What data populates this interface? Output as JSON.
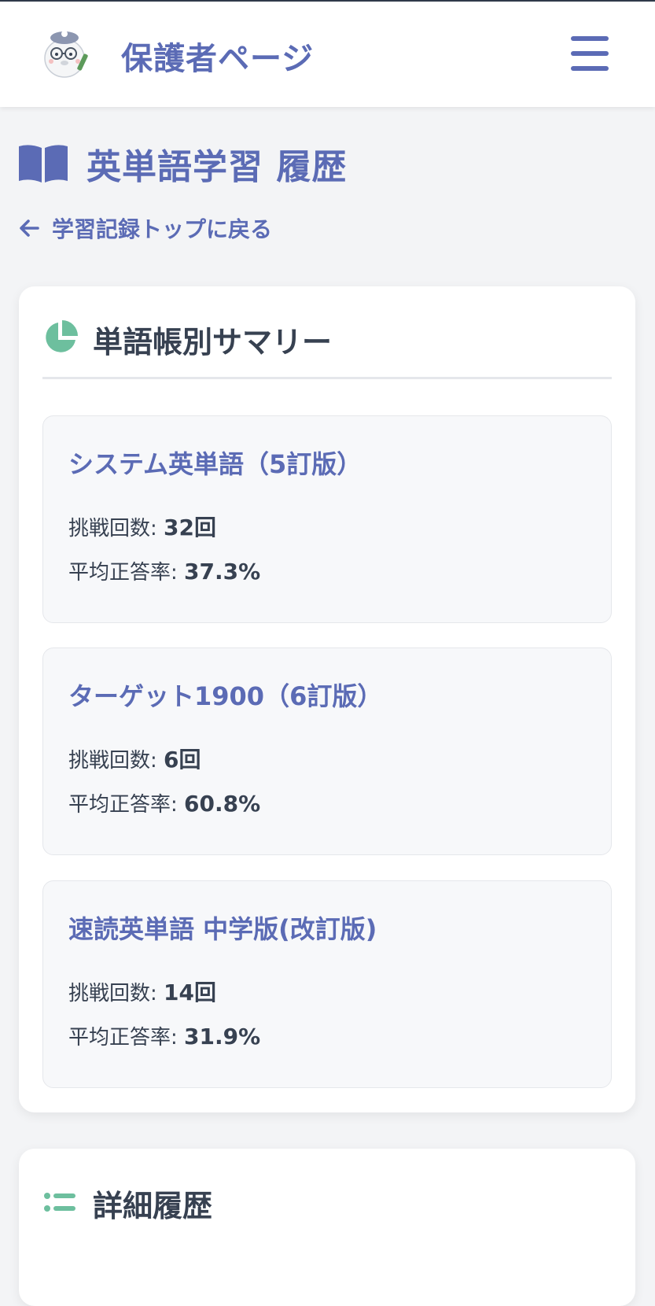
{
  "header": {
    "title": "保護者ページ",
    "menu_icon": "hamburger-menu-icon"
  },
  "page": {
    "title": "英単語学習 履歴",
    "title_icon": "book-open-icon",
    "back_link": "学習記録トップに戻る"
  },
  "summary": {
    "heading": "単語帳別サマリー",
    "heading_icon": "pie-chart-icon",
    "attempts_label": "挑戦回数:",
    "rate_label": "平均正答率:",
    "books": [
      {
        "name": "システム英単語（5訂版）",
        "attempts": "32回",
        "rate": "37.3%"
      },
      {
        "name": "ターゲット1900（6訂版）",
        "attempts": "6回",
        "rate": "60.8%"
      },
      {
        "name": "速読英単語 中学版(改訂版)",
        "attempts": "14回",
        "rate": "31.9%"
      }
    ]
  },
  "detail": {
    "heading": "詳細履歴",
    "heading_icon": "list-icon"
  },
  "colors": {
    "accent": "#5b6bb5",
    "icon_green": "#6dbf9e",
    "background": "#f3f4f6"
  }
}
